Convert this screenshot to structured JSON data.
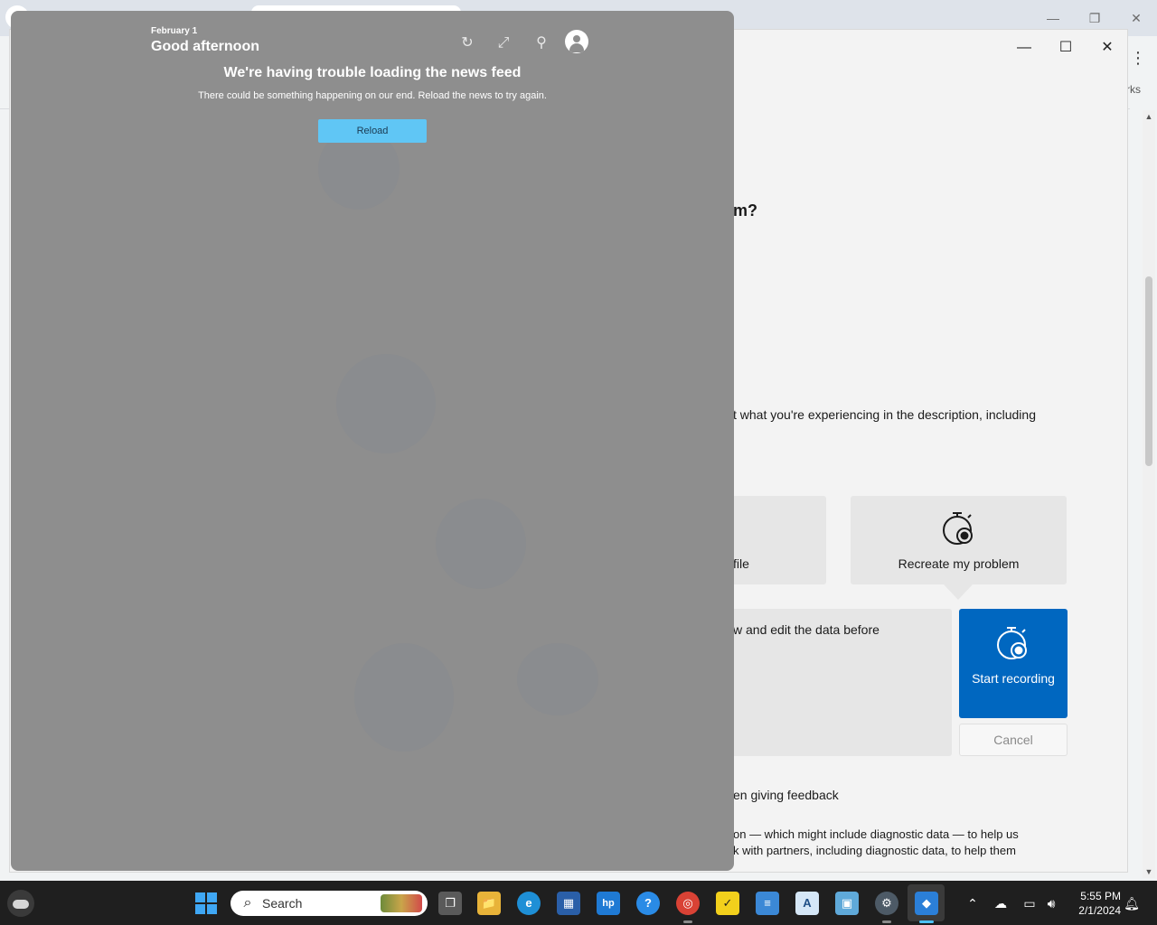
{
  "background_browser": {
    "bookmarks_fragment": "rks",
    "minimize_glyph": "—",
    "restore_glyph": "❐",
    "close_glyph": "✕"
  },
  "feedback_window": {
    "heading_fragment": "m?",
    "description_fragment": "t what you're experiencing in the description, including",
    "attach_file_fragment": "file",
    "recreate_label": "Recreate my problem",
    "review_fragment": "w and edit the data before",
    "start_recording_label": "Start recording",
    "cancel_label": "Cancel",
    "giving_feedback_fragment": "en giving feedback",
    "privacy_line1": "on — which might include diagnostic data — to help us",
    "privacy_line2": "k with partners, including diagnostic data, to help them",
    "accent_color": "#0067c0"
  },
  "widgets": {
    "date": "February 1",
    "greeting": "Good afternoon",
    "error_title": "We're having trouble loading the news feed",
    "error_message": "There could be something happening on our end. Reload the news to try again.",
    "reload_label": "Reload",
    "reload_color": "#60c6f5"
  },
  "taskbar": {
    "search_label": "Search",
    "apps": [
      {
        "name": "task-view",
        "glyph": "❐"
      },
      {
        "name": "file-explorer",
        "glyph": "📁"
      },
      {
        "name": "edge",
        "glyph": "e"
      },
      {
        "name": "store",
        "glyph": "▦"
      },
      {
        "name": "myhp",
        "glyph": "hp"
      },
      {
        "name": "help",
        "glyph": "?"
      },
      {
        "name": "chrome",
        "glyph": "◎"
      },
      {
        "name": "tasks",
        "glyph": "✓"
      },
      {
        "name": "notepad",
        "glyph": "≡"
      },
      {
        "name": "wordpad",
        "glyph": "A"
      },
      {
        "name": "control-panel",
        "glyph": "▣"
      },
      {
        "name": "settings",
        "glyph": "⚙"
      },
      {
        "name": "feedback-hub",
        "glyph": "◆"
      }
    ],
    "time": "5:55 PM",
    "date": "2/1/2024"
  }
}
